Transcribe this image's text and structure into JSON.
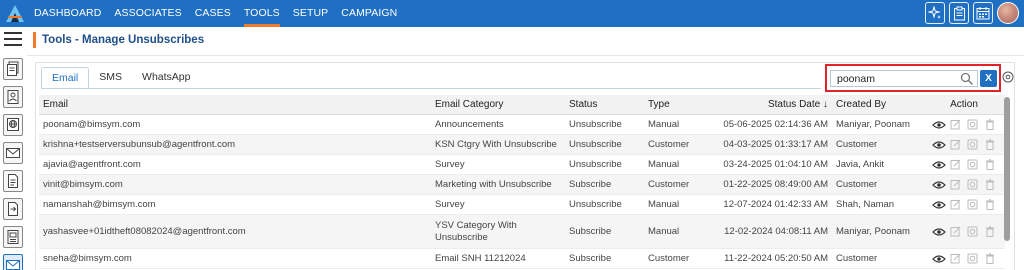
{
  "nav": {
    "items": [
      "DASHBOARD",
      "ASSOCIATES",
      "CASES",
      "TOOLS",
      "SETUP",
      "CAMPAIGN"
    ],
    "active": "TOOLS"
  },
  "header_icons": [
    "sparkle-icon",
    "clipboard-icon",
    "calendar-icon",
    "user-avatar"
  ],
  "left_rail_icons": [
    "documents-icon",
    "contact-card-icon",
    "globe-icon",
    "envelope-icon",
    "document-icon",
    "document-arrow-icon",
    "contact-list-icon",
    "mail-active-icon"
  ],
  "page": {
    "title": "Tools - Manage Unsubscribes"
  },
  "tabs": [
    "Email",
    "SMS",
    "WhatsApp"
  ],
  "active_tab": "Email",
  "search": {
    "value": "poonam",
    "clear_label": "X"
  },
  "table": {
    "headers": {
      "email": "Email",
      "category": "Email Category",
      "status": "Status",
      "type": "Type",
      "status_date": "Status Date",
      "sort_indicator": "↓",
      "created_by": "Created By",
      "action": "Action"
    },
    "rows": [
      {
        "email": "poonam@bimsym.com",
        "category": "Announcements",
        "status": "Unsubscribe",
        "type": "Manual",
        "date": "05-06-2025 02:14:36 AM",
        "created_by": "Maniyar, Poonam"
      },
      {
        "email": "krishna+testserversubunsub@agentfront.com",
        "category": "KSN Ctgry With Unsubscribe",
        "status": "Unsubscribe",
        "type": "Customer",
        "date": "04-03-2025 01:33:17 AM",
        "created_by": "Customer"
      },
      {
        "email": "ajavia@agentfront.com",
        "category": "Survey",
        "status": "Unsubscribe",
        "type": "Manual",
        "date": "03-24-2025 01:04:10 AM",
        "created_by": "Javia, Ankit"
      },
      {
        "email": "vinit@bimsym.com",
        "category": "Marketing with Unsubscribe",
        "status": "Subscribe",
        "type": "Customer",
        "date": "01-22-2025 08:49:00 AM",
        "created_by": "Customer"
      },
      {
        "email": "namanshah@bimsym.com",
        "category": "Survey",
        "status": "Unsubscribe",
        "type": "Manual",
        "date": "12-07-2024 01:42:33 AM",
        "created_by": "Shah, Naman"
      },
      {
        "email": "yashasvee+01idtheft08082024@agentfront.com",
        "category": "YSV Category With Unsubscribe",
        "status": "Subscribe",
        "type": "Manual",
        "date": "12-02-2024 04:08:11 AM",
        "created_by": "Maniyar, Poonam"
      },
      {
        "email": "sneha@bimsym.com",
        "category": "Email SNH 11212024",
        "status": "Subscribe",
        "type": "Customer",
        "date": "11-22-2024 05:20:50 AM",
        "created_by": "Customer"
      }
    ],
    "row_actions": [
      "view-icon",
      "edit-icon",
      "history-icon",
      "delete-icon"
    ]
  },
  "colors": {
    "header_bg": "#1f6fc3",
    "accent": "#f07c2b",
    "highlight_border": "#e0252a"
  }
}
